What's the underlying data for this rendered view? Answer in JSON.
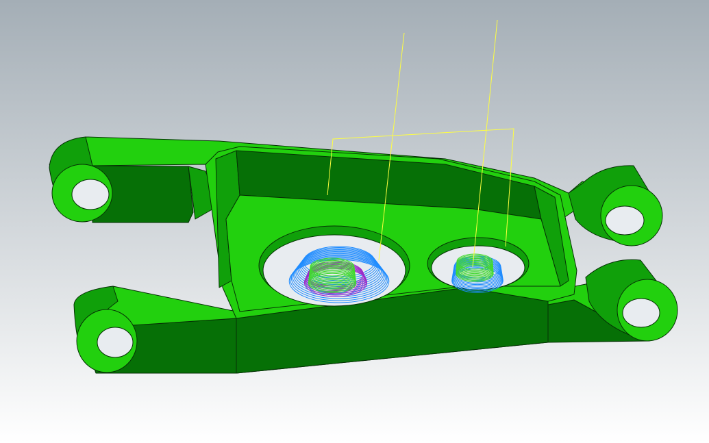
{
  "viewport": {
    "background_top": "#a4aeb6",
    "background_bottom": "#ffffff"
  },
  "part": {
    "type": "suspension-link",
    "colors": {
      "top_face": "#22d00e",
      "side_face": "#10a00a",
      "dark_face": "#067006",
      "edge": "#053005",
      "hole_floor": "#e8ecf0"
    }
  },
  "toolpaths": {
    "rapid_color": "#ffff40",
    "cut_color": "#1f8cff",
    "finish_color": "#42d830",
    "plunge_color": "#9c2ac8"
  }
}
